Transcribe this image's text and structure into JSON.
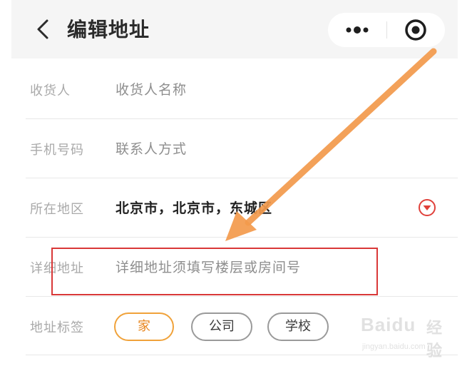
{
  "navbar": {
    "title": "编辑地址",
    "back_icon": "chevron-left-icon",
    "more_icon": "more-dots-icon",
    "close_icon": "target-icon"
  },
  "form": {
    "recipient": {
      "label": "收货人",
      "placeholder": "收货人名称"
    },
    "phone": {
      "label": "手机号码",
      "placeholder": "联系人方式"
    },
    "region": {
      "label": "所在地区",
      "value": "北京市，北京市，东城区",
      "dropdown_icon": "dropdown-circle-icon"
    },
    "detail": {
      "label": "详细地址",
      "placeholder": "详细地址须填写楼层或房间号"
    },
    "tags": {
      "label": "地址标签",
      "items": [
        "家",
        "公司",
        "学校"
      ],
      "selected": "家"
    }
  },
  "colors": {
    "accent": "#f0a23a",
    "highlight_box": "#d93838",
    "arrow": "#f39a4c",
    "dropdown": "#e0403a"
  },
  "watermark": {
    "brand": "Baidu",
    "tail": "经验",
    "url": "jingyan.baidu.com"
  }
}
